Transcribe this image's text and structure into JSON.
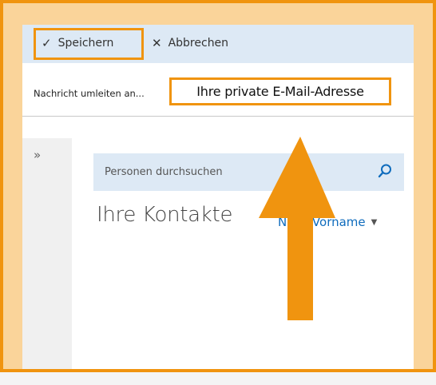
{
  "toolbar": {
    "save_label": "Speichern",
    "cancel_label": "Abbrechen"
  },
  "redirect": {
    "label": "Nachricht umleiten an...",
    "email_value": "Ihre private E-Mail-Adresse"
  },
  "sidebar": {
    "expand_glyph": "»"
  },
  "search": {
    "placeholder": "Personen durchsuchen"
  },
  "contacts": {
    "title": "Ihre Kontakte",
    "sort_label": "Nach Vorname"
  },
  "colors": {
    "highlight": "#f0940f",
    "highlight_fill": "#fad49a",
    "toolbar_bg": "#dde9f5",
    "link": "#0f6cbd"
  },
  "icons": [
    "check-icon",
    "close-icon",
    "expand-icon",
    "search-icon",
    "chevron-down-icon",
    "annotation-arrow-icon"
  ]
}
